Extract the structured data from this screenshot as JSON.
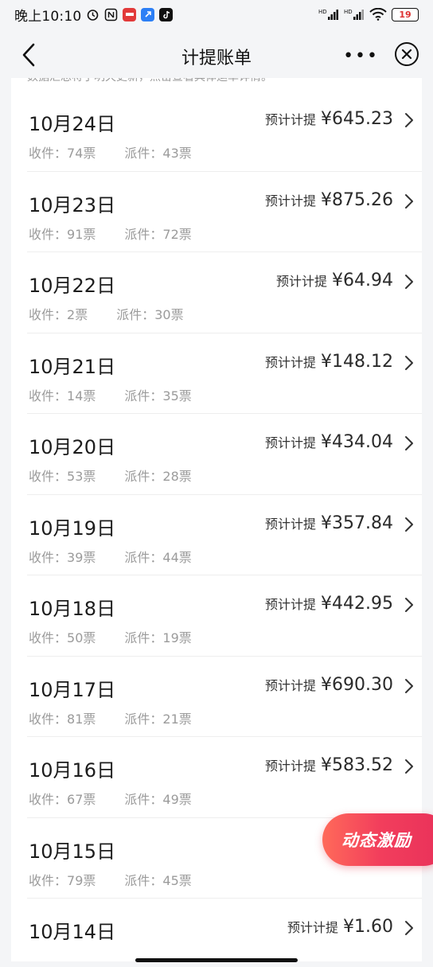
{
  "status_bar": {
    "time": "晚上10:10",
    "battery_level": "19",
    "network_labels": [
      "HD",
      "HD"
    ]
  },
  "nav": {
    "title": "计提账单",
    "more_glyph": "•••"
  },
  "notice_text": "数据汇总将于明天更新，点击查看具体运单详情。",
  "amount_label": "预计计提",
  "receive_label": "收件：",
  "dispatch_label": "派件：",
  "unit": "票",
  "rows": [
    {
      "date": "10月24日",
      "amount": "¥645.23",
      "receive": "74票",
      "dispatch": "43票"
    },
    {
      "date": "10月23日",
      "amount": "¥875.26",
      "receive": "91票",
      "dispatch": "72票"
    },
    {
      "date": "10月22日",
      "amount": "¥64.94",
      "receive": "2票",
      "dispatch": "30票"
    },
    {
      "date": "10月21日",
      "amount": "¥148.12",
      "receive": "14票",
      "dispatch": "35票"
    },
    {
      "date": "10月20日",
      "amount": "¥434.04",
      "receive": "53票",
      "dispatch": "28票"
    },
    {
      "date": "10月19日",
      "amount": "¥357.84",
      "receive": "39票",
      "dispatch": "44票"
    },
    {
      "date": "10月18日",
      "amount": "¥442.95",
      "receive": "50票",
      "dispatch": "19票"
    },
    {
      "date": "10月17日",
      "amount": "¥690.30",
      "receive": "81票",
      "dispatch": "21票"
    },
    {
      "date": "10月16日",
      "amount": "¥583.52",
      "receive": "67票",
      "dispatch": "49票"
    },
    {
      "date": "10月15日",
      "amount": "¥",
      "receive": "79票",
      "dispatch": "45票"
    },
    {
      "date": "10月14日",
      "amount": "¥1.60",
      "receive": "",
      "dispatch": ""
    }
  ],
  "promo": {
    "label": "动态激励"
  },
  "colors": {
    "page_bg": "#f4f5f7",
    "card_bg": "#ffffff",
    "muted_text": "#9b9b9b",
    "promo_start": "#ff6a5a",
    "promo_end": "#e8305a"
  }
}
